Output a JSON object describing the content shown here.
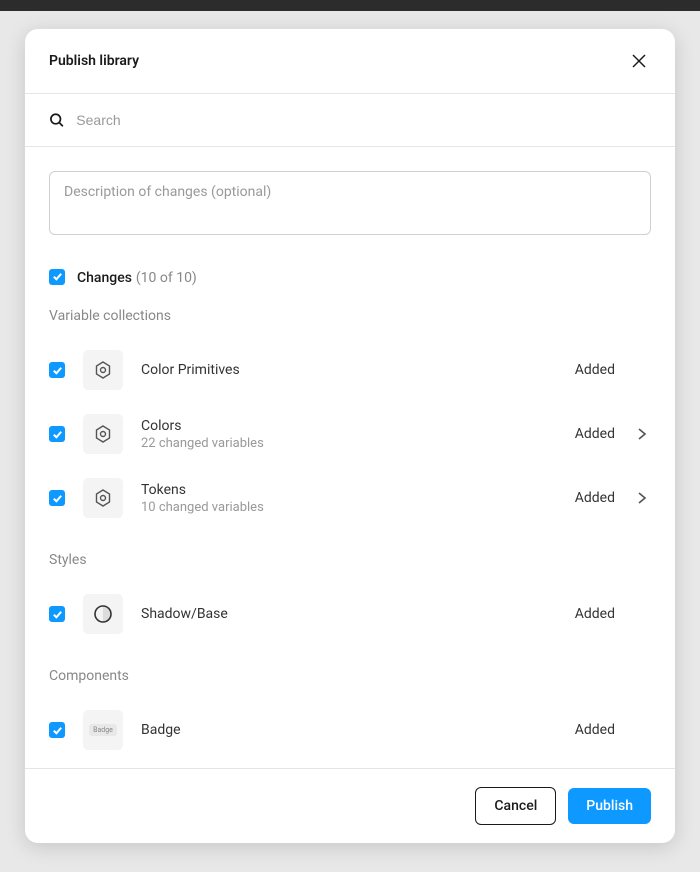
{
  "modal": {
    "title": "Publish library",
    "search": {
      "placeholder": "Search"
    },
    "description": {
      "placeholder": "Description of changes (optional)"
    },
    "changes": {
      "label": "Changes",
      "count": "(10 of 10)"
    },
    "sections": {
      "variable_collections": "Variable collections",
      "styles": "Styles",
      "components": "Components"
    },
    "items": {
      "color_primitives": {
        "name": "Color Primitives",
        "status": "Added"
      },
      "colors": {
        "name": "Colors",
        "sub": "22 changed variables",
        "status": "Added"
      },
      "tokens": {
        "name": "Tokens",
        "sub": "10 changed variables",
        "status": "Added"
      },
      "shadow_base": {
        "name": "Shadow/Base",
        "status": "Added"
      },
      "badge": {
        "name": "Badge",
        "status": "Added",
        "preview": "Badge"
      }
    },
    "footer": {
      "cancel": "Cancel",
      "publish": "Publish"
    }
  }
}
